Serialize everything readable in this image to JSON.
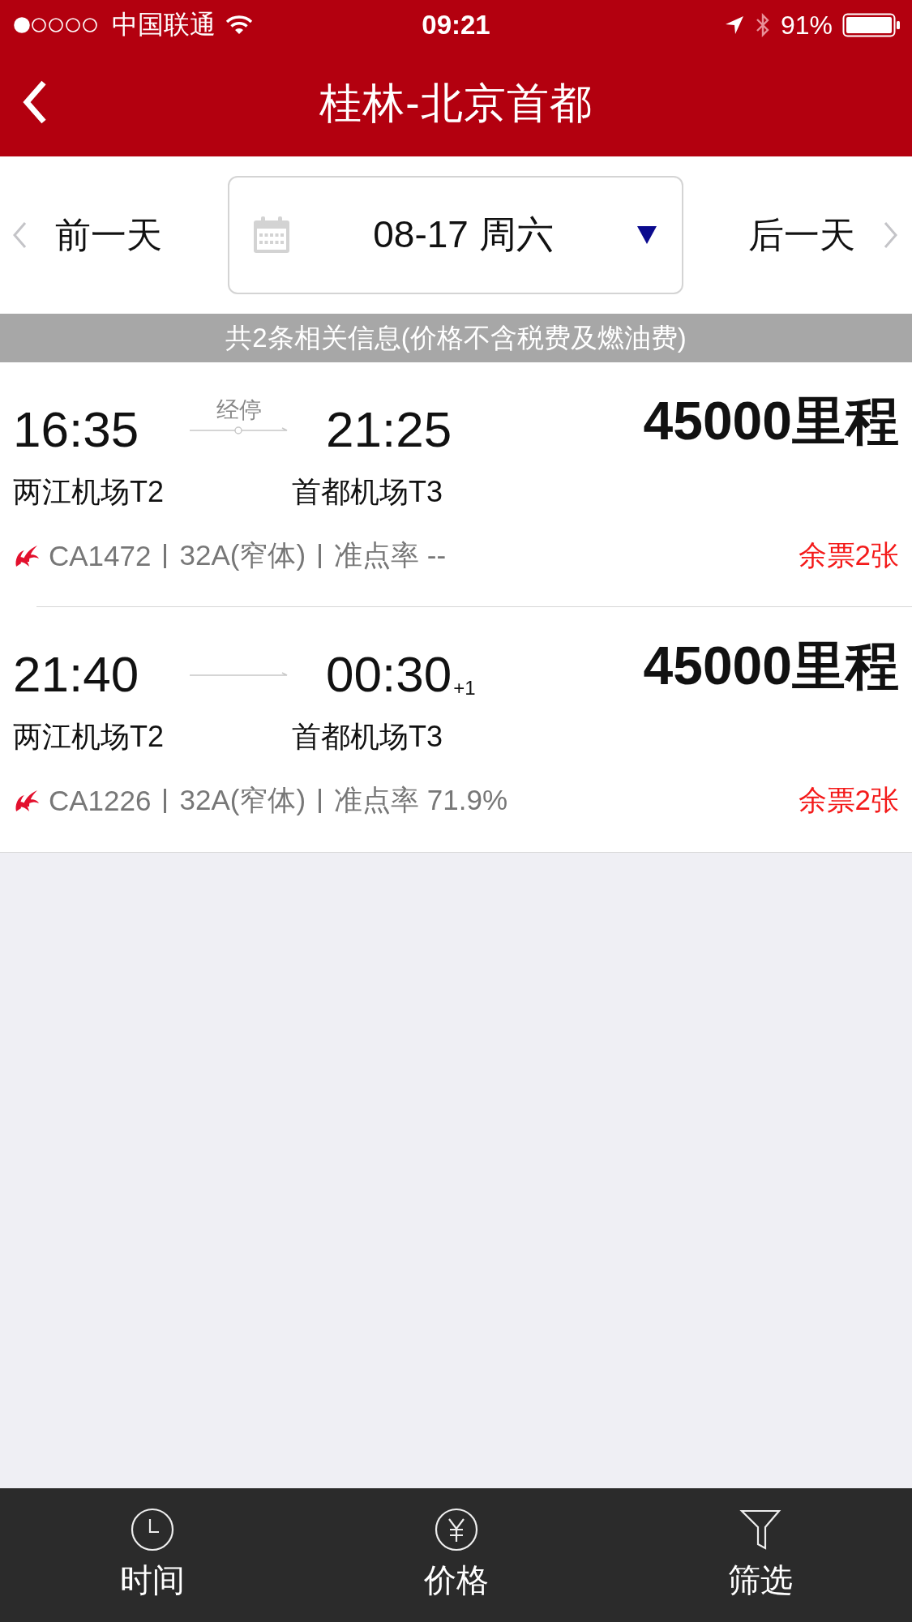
{
  "status_bar": {
    "carrier": "中国联通",
    "time": "09:21",
    "battery": "91%"
  },
  "nav": {
    "title": "桂林-北京首都"
  },
  "date_bar": {
    "prev": "前一天",
    "date": "08-17 周六",
    "next": "后一天"
  },
  "banner": "共2条相关信息(价格不含税费及燃油费)",
  "flights": [
    {
      "dep_time": "16:35",
      "stop": "经停",
      "arr_time": "21:25",
      "dep_airport": "两江机场T2",
      "arr_airport": "首都机场T3",
      "flight_no": "CA1472",
      "aircraft": "32A(窄体)",
      "on_time": "准点率 --",
      "price": "45000里程",
      "seats": "余票2张"
    },
    {
      "dep_time": "21:40",
      "arr_time": "00:30",
      "day_offset": "+1",
      "dep_airport": "两江机场T2",
      "arr_airport": "首都机场T3",
      "flight_no": "CA1226",
      "aircraft": "32A(窄体)",
      "on_time": "准点率 71.9%",
      "price": "45000里程",
      "seats": "余票2张"
    }
  ],
  "tabs": [
    {
      "kind": "time",
      "label": "时间"
    },
    {
      "kind": "price",
      "label": "价格"
    },
    {
      "kind": "filter",
      "label": "筛选"
    }
  ]
}
